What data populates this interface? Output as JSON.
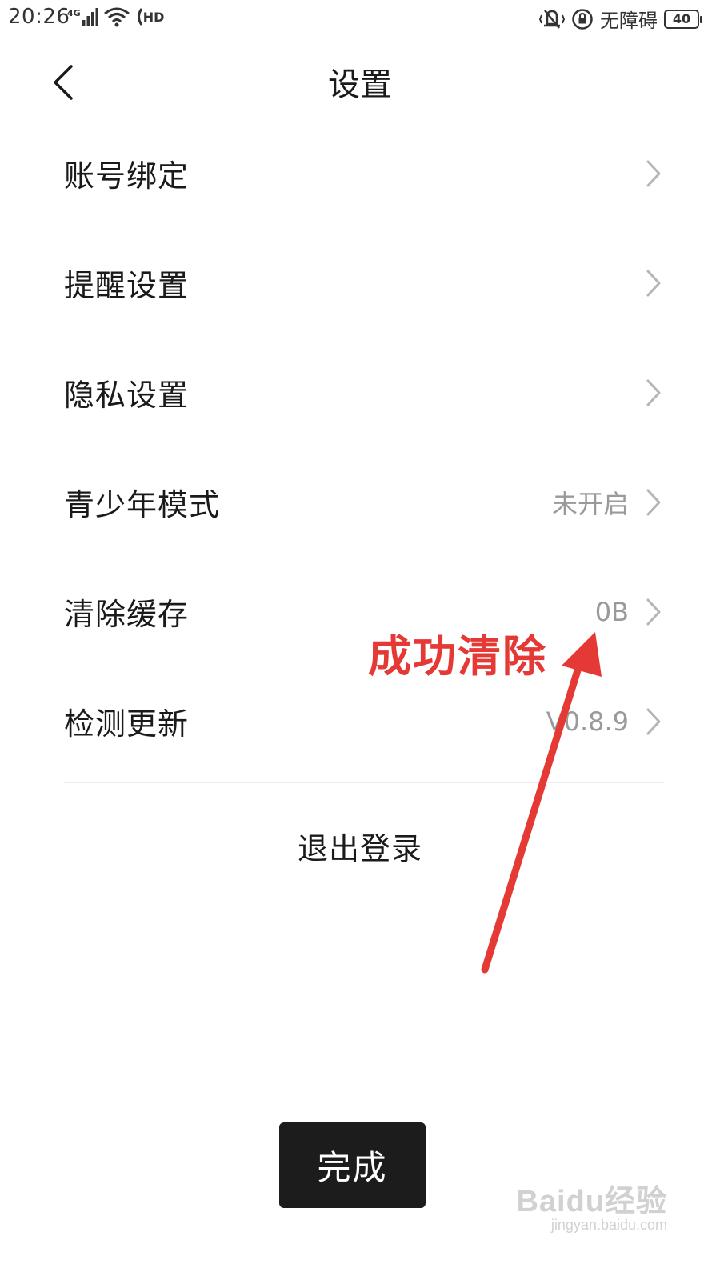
{
  "status_bar": {
    "time": "20:26",
    "network": "4G",
    "hd_label": "HD",
    "accessibility": "无障碍",
    "battery": "40"
  },
  "header": {
    "title": "设置"
  },
  "settings": [
    {
      "label": "账号绑定",
      "value": ""
    },
    {
      "label": "提醒设置",
      "value": ""
    },
    {
      "label": "隐私设置",
      "value": ""
    },
    {
      "label": "青少年模式",
      "value": "未开启"
    },
    {
      "label": "清除缓存",
      "value": "0B"
    },
    {
      "label": "检测更新",
      "value": "V0.8.9"
    }
  ],
  "logout_label": "退出登录",
  "done_label": "完成",
  "annotation": {
    "text": "成功清除",
    "color": "#e53935"
  },
  "watermark": {
    "logo": "Baidu经验",
    "url": "jingyan.baidu.com"
  }
}
